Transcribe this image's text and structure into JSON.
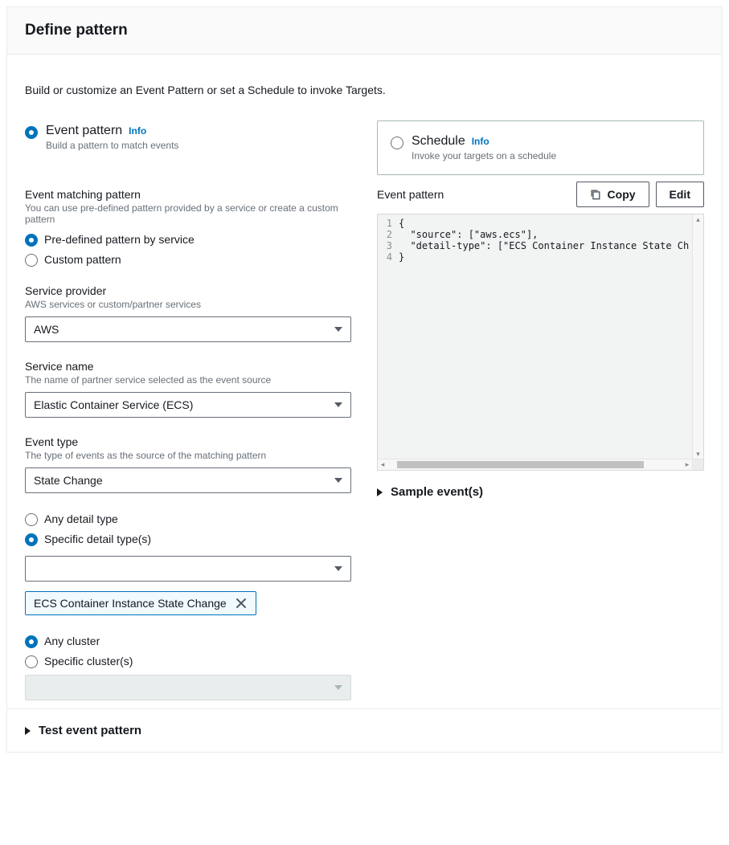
{
  "header": {
    "title": "Define pattern"
  },
  "intro": "Build or customize an Event Pattern or set a Schedule to invoke Targets.",
  "topOptions": {
    "eventPattern": {
      "title": "Event pattern",
      "info": "Info",
      "desc": "Build a pattern to match events",
      "selected": true
    },
    "schedule": {
      "title": "Schedule",
      "info": "Info",
      "desc": "Invoke your targets on a schedule",
      "selected": false
    }
  },
  "eventMatching": {
    "title": "Event matching pattern",
    "hint": "You can use pre-defined pattern provided by a service or create a custom pattern",
    "predefined": {
      "label": "Pre-defined pattern by service",
      "selected": true
    },
    "custom": {
      "label": "Custom pattern",
      "selected": false
    }
  },
  "serviceProvider": {
    "title": "Service provider",
    "hint": "AWS services or custom/partner services",
    "value": "AWS"
  },
  "serviceName": {
    "title": "Service name",
    "hint": "The name of partner service selected as the event source",
    "value": "Elastic Container Service (ECS)"
  },
  "eventType": {
    "title": "Event type",
    "hint": "The type of events as the source of the matching pattern",
    "value": "State Change"
  },
  "detailType": {
    "any": {
      "label": "Any detail type",
      "selected": false
    },
    "specific": {
      "label": "Specific detail type(s)",
      "selected": true
    },
    "selectValue": "",
    "tag": "ECS Container Instance State Change"
  },
  "cluster": {
    "any": {
      "label": "Any cluster",
      "selected": true
    },
    "specific": {
      "label": "Specific cluster(s)",
      "selected": false
    },
    "selectValue": ""
  },
  "eventPatternPanel": {
    "title": "Event pattern",
    "copy": "Copy",
    "edit": "Edit",
    "code": {
      "lines": [
        "1",
        "2",
        "3",
        "4"
      ],
      "text": "{\n  \"source\": [\"aws.ecs\"],\n  \"detail-type\": [\"ECS Container Instance State Ch\n}"
    }
  },
  "sampleEvents": {
    "label": "Sample event(s)"
  },
  "testPattern": {
    "label": "Test event pattern"
  }
}
